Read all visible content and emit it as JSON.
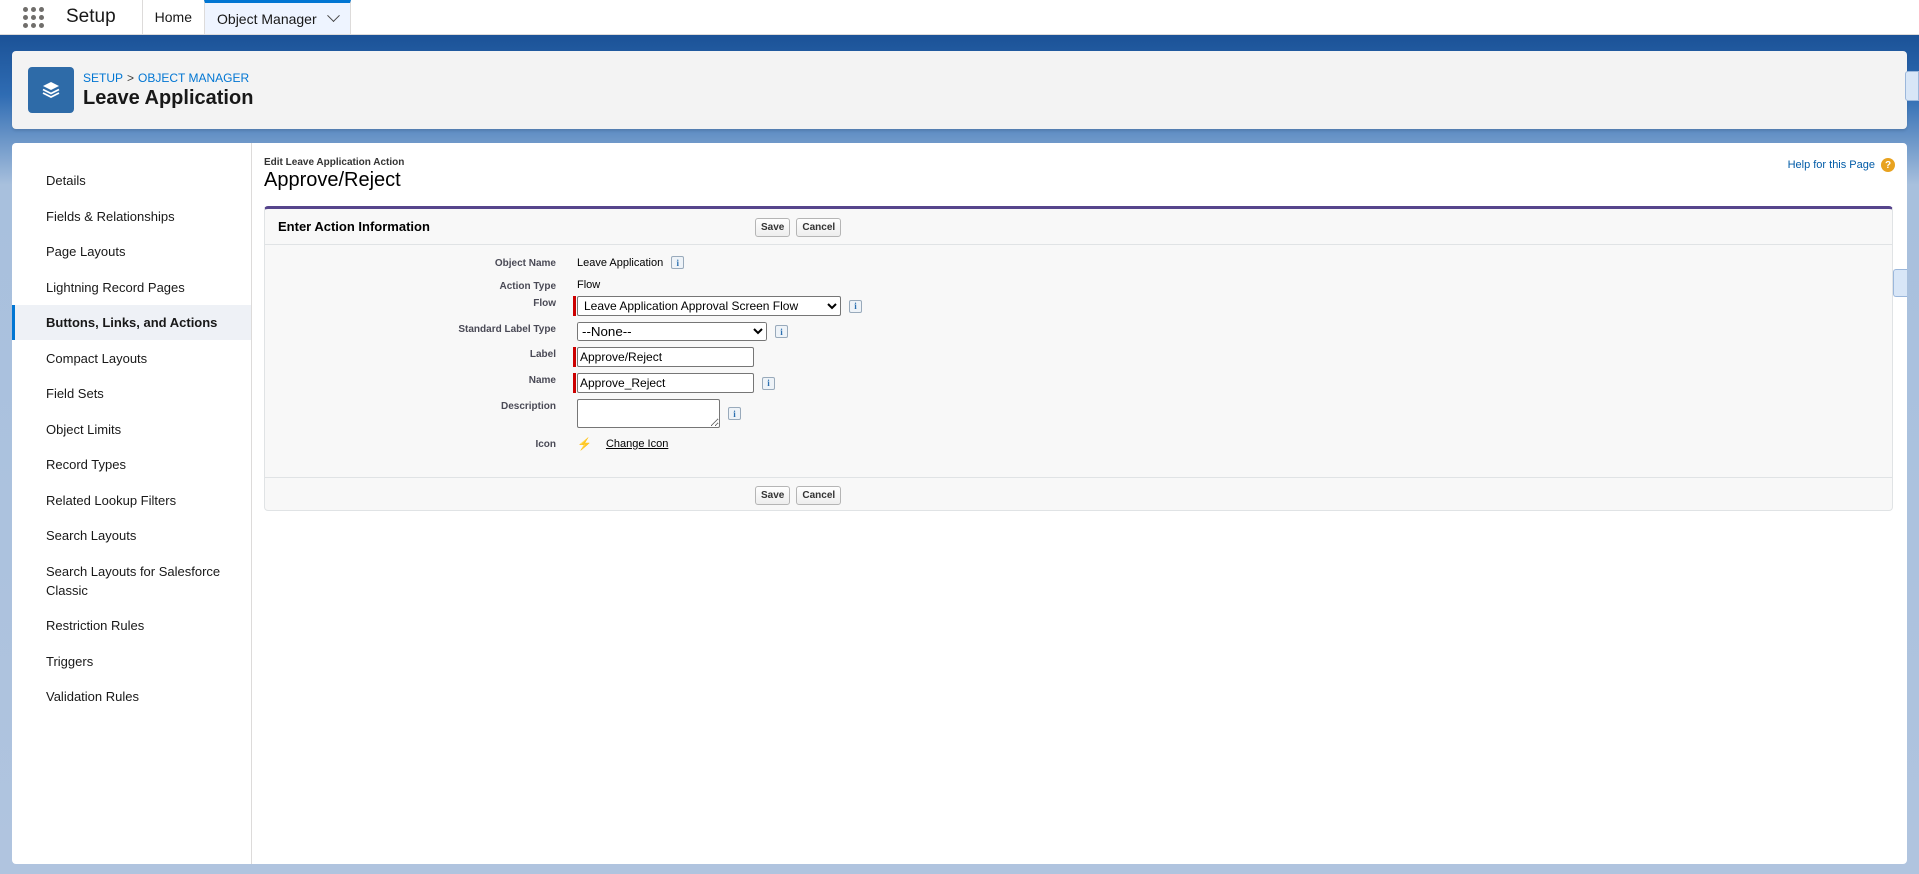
{
  "topnav": {
    "app_name": "Setup",
    "tabs": [
      {
        "label": "Home"
      },
      {
        "label": "Object Manager"
      }
    ]
  },
  "header": {
    "breadcrumb": [
      "SETUP",
      "OBJECT MANAGER"
    ],
    "breadcrumb_separator": ">",
    "title": "Leave Application"
  },
  "sidebar": {
    "items": [
      {
        "label": "Details"
      },
      {
        "label": "Fields & Relationships"
      },
      {
        "label": "Page Layouts"
      },
      {
        "label": "Lightning Record Pages"
      },
      {
        "label": "Buttons, Links, and Actions"
      },
      {
        "label": "Compact Layouts"
      },
      {
        "label": "Field Sets"
      },
      {
        "label": "Object Limits"
      },
      {
        "label": "Record Types"
      },
      {
        "label": "Related Lookup Filters"
      },
      {
        "label": "Search Layouts"
      },
      {
        "label": "Search Layouts for Salesforce Classic"
      },
      {
        "label": "Restriction Rules"
      },
      {
        "label": "Triggers"
      },
      {
        "label": "Validation Rules"
      }
    ],
    "selected_index": 4
  },
  "content": {
    "edit_label": "Edit Leave Application Action",
    "edit_title": "Approve/Reject",
    "help_link": "Help for this Page",
    "help_icon_glyph": "?",
    "section_title": "Enter Action Information",
    "save_label": "Save",
    "cancel_label": "Cancel"
  },
  "form": {
    "object_name": {
      "label": "Object Name",
      "value": "Leave Application"
    },
    "action_type": {
      "label": "Action Type",
      "value": "Flow"
    },
    "flow": {
      "label": "Flow",
      "selected": "Leave Application Approval Screen Flow"
    },
    "standard_label_type": {
      "label": "Standard Label Type",
      "selected": "--None--"
    },
    "label_field": {
      "label": "Label",
      "value": "Approve/Reject"
    },
    "name_field": {
      "label": "Name",
      "value": "Approve_Reject"
    },
    "description": {
      "label": "Description",
      "value": ""
    },
    "icon": {
      "label": "Icon",
      "glyph": "⚡",
      "change_link": "Change Icon"
    },
    "info_glyph": "i"
  },
  "colors": {
    "accent": "#0176d3",
    "header_icon_bg": "#2e6ba8",
    "required_bar": "#cc0000",
    "block_top_border": "#56458c",
    "help_icon": "#e8a21f"
  }
}
